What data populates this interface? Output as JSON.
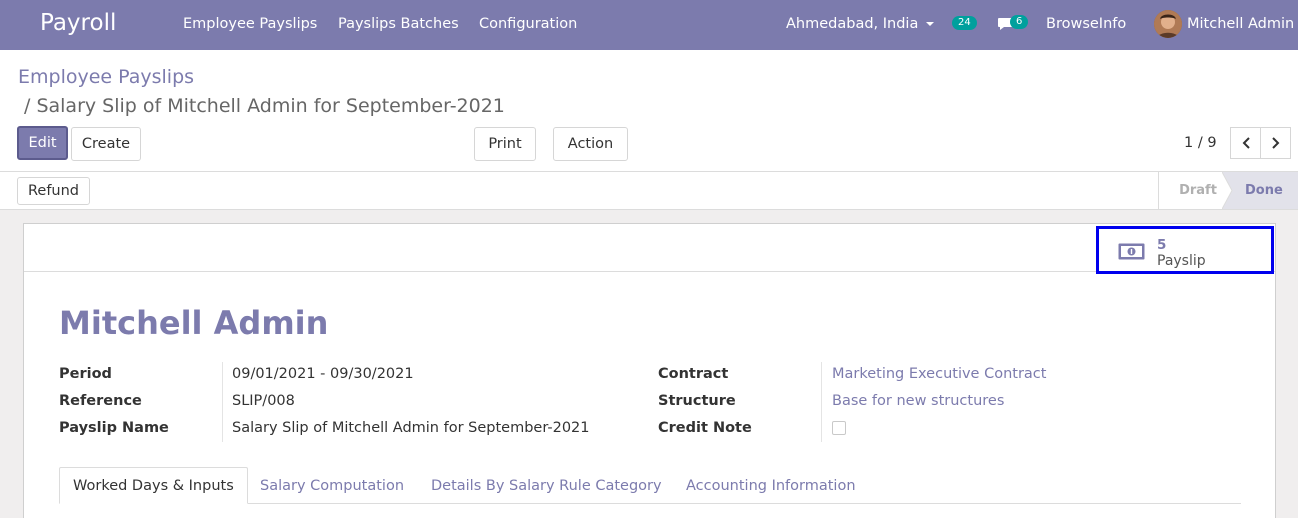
{
  "navbar": {
    "app_name": "Payroll",
    "menu": [
      "Employee Payslips",
      "Payslips Batches",
      "Configuration"
    ],
    "company": "Ahmedabad, India",
    "activity_count": "24",
    "message_count": "6",
    "browseinfo": "BrowseInfo",
    "user": "Mitchell Admin"
  },
  "breadcrumb": {
    "parent": "Employee Payslips",
    "current": "/ Salary Slip of Mitchell Admin for September-2021"
  },
  "buttons": {
    "edit": "Edit",
    "create": "Create",
    "print": "Print",
    "action": "Action",
    "refund": "Refund"
  },
  "pager": {
    "value": "1 / 9"
  },
  "status": {
    "draft": "Draft",
    "done": "Done"
  },
  "smart_button": {
    "value": "5",
    "label": "Payslip"
  },
  "form": {
    "employee": "Mitchell Admin",
    "period_label": "Period",
    "period_value": "09/01/2021 - 09/30/2021",
    "reference_label": "Reference",
    "reference_value": "SLIP/008",
    "payslip_name_label": "Payslip Name",
    "payslip_name_value": "Salary Slip of Mitchell Admin for September-2021",
    "contract_label": "Contract",
    "contract_value": "Marketing Executive Contract",
    "structure_label": "Structure",
    "structure_value": "Base for new structures",
    "credit_note_label": "Credit Note",
    "credit_note_checked": false
  },
  "tabs": [
    "Worked Days & Inputs",
    "Salary Computation",
    "Details By Salary Rule Category",
    "Accounting Information"
  ],
  "colors": {
    "brand": "#7c7bad",
    "badge": "#00a09d",
    "highlight_border": "#0000ee"
  }
}
